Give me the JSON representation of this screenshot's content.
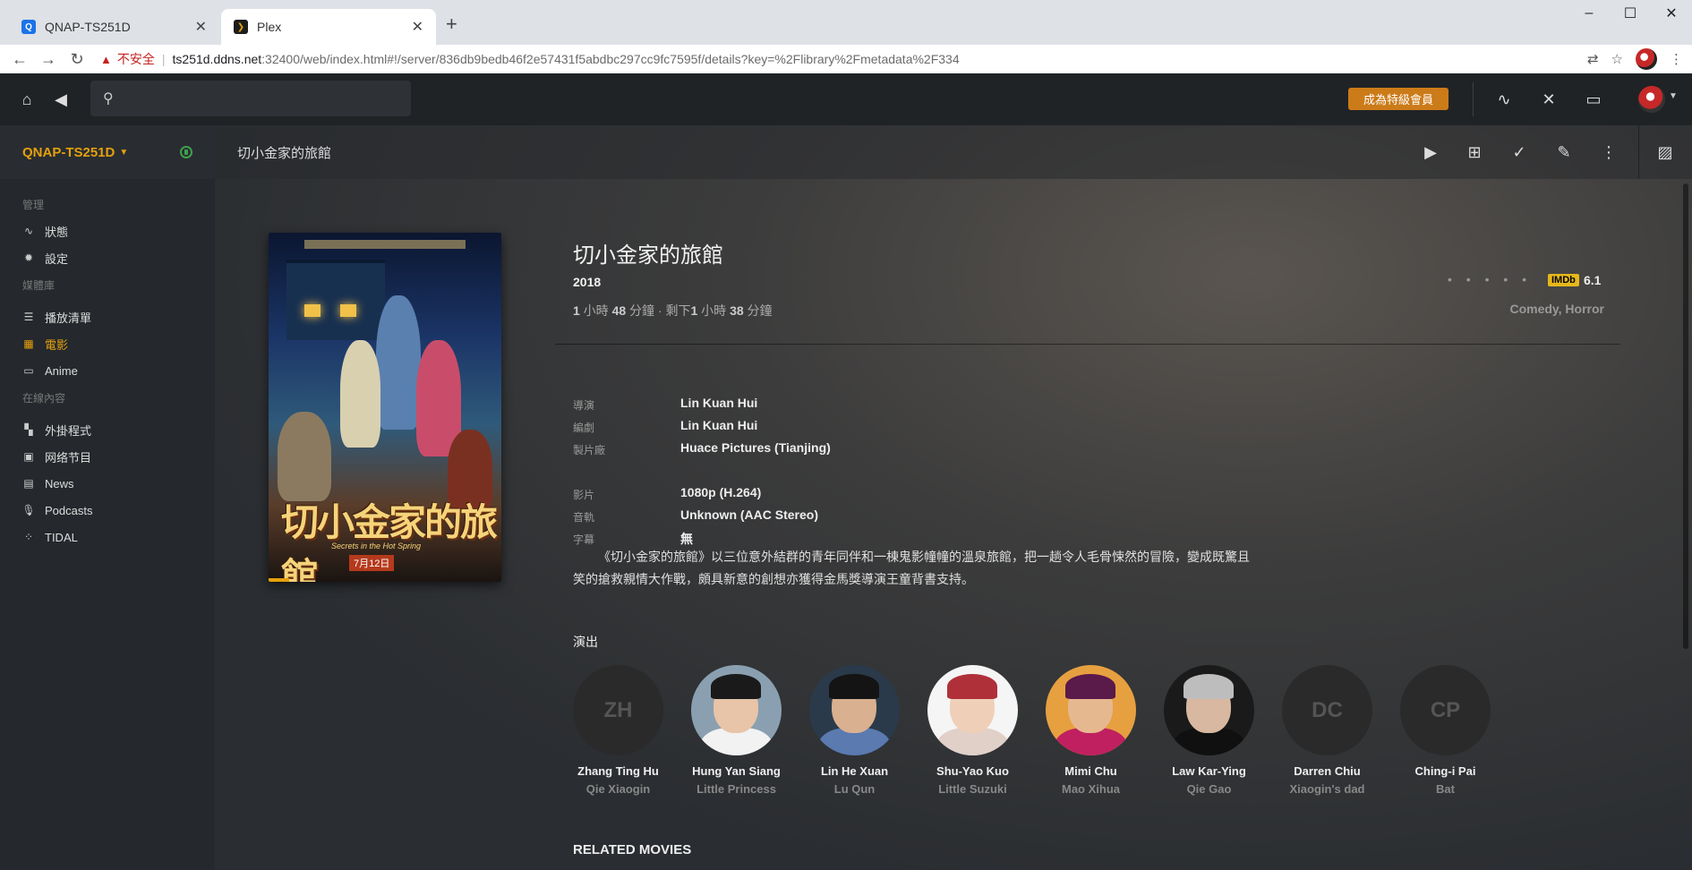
{
  "browser": {
    "tabs": [
      {
        "title": "QNAP-TS251D",
        "icon": "qnap-icon"
      },
      {
        "title": "Plex",
        "icon": "plex-icon"
      }
    ],
    "new_tab": "+",
    "address": {
      "insecure_label": "不安全",
      "host": "ts251d.ddns.net",
      "path": ":32400/web/index.html#!/server/836db9bedb46f2e57431f5abdbc297cc9fc7595f/details?key=%2Flibrary%2Fmetadata%2F334"
    }
  },
  "plex": {
    "search_placeholder": "",
    "premium_button": "成為特級會員"
  },
  "sidebar": {
    "server_name": "QNAP-TS251D",
    "sections": [
      {
        "heading": "管理",
        "items": [
          {
            "label": "狀態",
            "icon": "activity-icon"
          },
          {
            "label": "設定",
            "icon": "gear-icon"
          }
        ]
      },
      {
        "heading": "媒體庫",
        "items": [
          {
            "label": "播放清單",
            "icon": "list-icon"
          },
          {
            "label": "電影",
            "icon": "film-icon",
            "active": true
          },
          {
            "label": "Anime",
            "icon": "monitor-icon"
          }
        ]
      },
      {
        "heading": "在線內容",
        "items": [
          {
            "label": "外掛程式",
            "icon": "grid-icon"
          },
          {
            "label": "网络节目",
            "icon": "webshows-icon"
          },
          {
            "label": "News",
            "icon": "news-icon"
          },
          {
            "label": "Podcasts",
            "icon": "mic-icon"
          },
          {
            "label": "TIDAL",
            "icon": "tidal-icon"
          }
        ]
      }
    ]
  },
  "main": {
    "breadcrumb_title": "切小金家的旅館",
    "movie": {
      "title": "切小金家的旅館",
      "year": "2018",
      "duration_parts": [
        "1",
        " 小時 ",
        "48",
        " 分鐘 · 剩下",
        "1",
        " 小時 ",
        "38",
        " 分鐘"
      ],
      "rating_dots": "• • • • •",
      "imdb_label": "IMDb",
      "imdb_score": "6.1",
      "genres": "Comedy, Horror",
      "watch_progress": 0.09,
      "poster_text": {
        "title": "切小金家的旅館",
        "subtitle": "Secrets in the Hot Spring",
        "date": "7月12日"
      }
    },
    "details": [
      {
        "label": "導演",
        "value": "Lin Kuan Hui"
      },
      {
        "label": "編劇",
        "value": "Lin Kuan Hui"
      },
      {
        "label": "製片廠",
        "value": "Huace Pictures (Tianjing)"
      },
      {
        "label": "影片",
        "value": "1080p (H.264)"
      },
      {
        "label": "音軌",
        "value": "Unknown (AAC Stereo)"
      },
      {
        "label": "字幕",
        "value": "無"
      }
    ],
    "summary": "《切小金家的旅館》以三位意外結群的青年同伴和一棟鬼影幢幢的溫泉旅館，把一趟令人毛骨悚然的冒險，變成既驚且笑的搶救親情大作戰，頗具新意的創想亦獲得金馬獎導演王童背書支持。",
    "cast_heading": "演出",
    "cast": [
      {
        "name": "Zhang Ting Hu",
        "role": "Qie Xiaogin",
        "initials": "ZH"
      },
      {
        "name": "Hung Yan Siang",
        "role": "Little Princess",
        "photo": true,
        "skin": "#e8c4a8",
        "hair": "#1a1a1a",
        "bg": "#8aa0b0",
        "shirt": "#f2f2f2"
      },
      {
        "name": "Lin He Xuan",
        "role": "Lu Qun",
        "photo": true,
        "skin": "#d9b090",
        "hair": "#141414",
        "bg": "#2b3a4a",
        "shirt": "#5a7ab0"
      },
      {
        "name": "Shu-Yao Kuo",
        "role": "Little Suzuki",
        "photo": true,
        "skin": "#f0cfb8",
        "hair": "#b0303a",
        "bg": "#f5f5f5",
        "shirt": "#e0d0c8"
      },
      {
        "name": "Mimi Chu",
        "role": "Mao Xihua",
        "photo": true,
        "skin": "#e6b890",
        "hair": "#5a1a4a",
        "bg": "#e7a040",
        "shirt": "#c02060"
      },
      {
        "name": "Law Kar-Ying",
        "role": "Qie Gao",
        "photo": true,
        "skin": "#d8b8a0",
        "hair": "#bdbdbd",
        "bg": "#1a1a1a",
        "shirt": "#101010"
      },
      {
        "name": "Darren Chiu",
        "role": "Xiaogin's dad",
        "initials": "DC"
      },
      {
        "name": "Ching-i Pai",
        "role": "Bat",
        "initials": "CP"
      }
    ],
    "related_heading": "RELATED MOVIES"
  }
}
